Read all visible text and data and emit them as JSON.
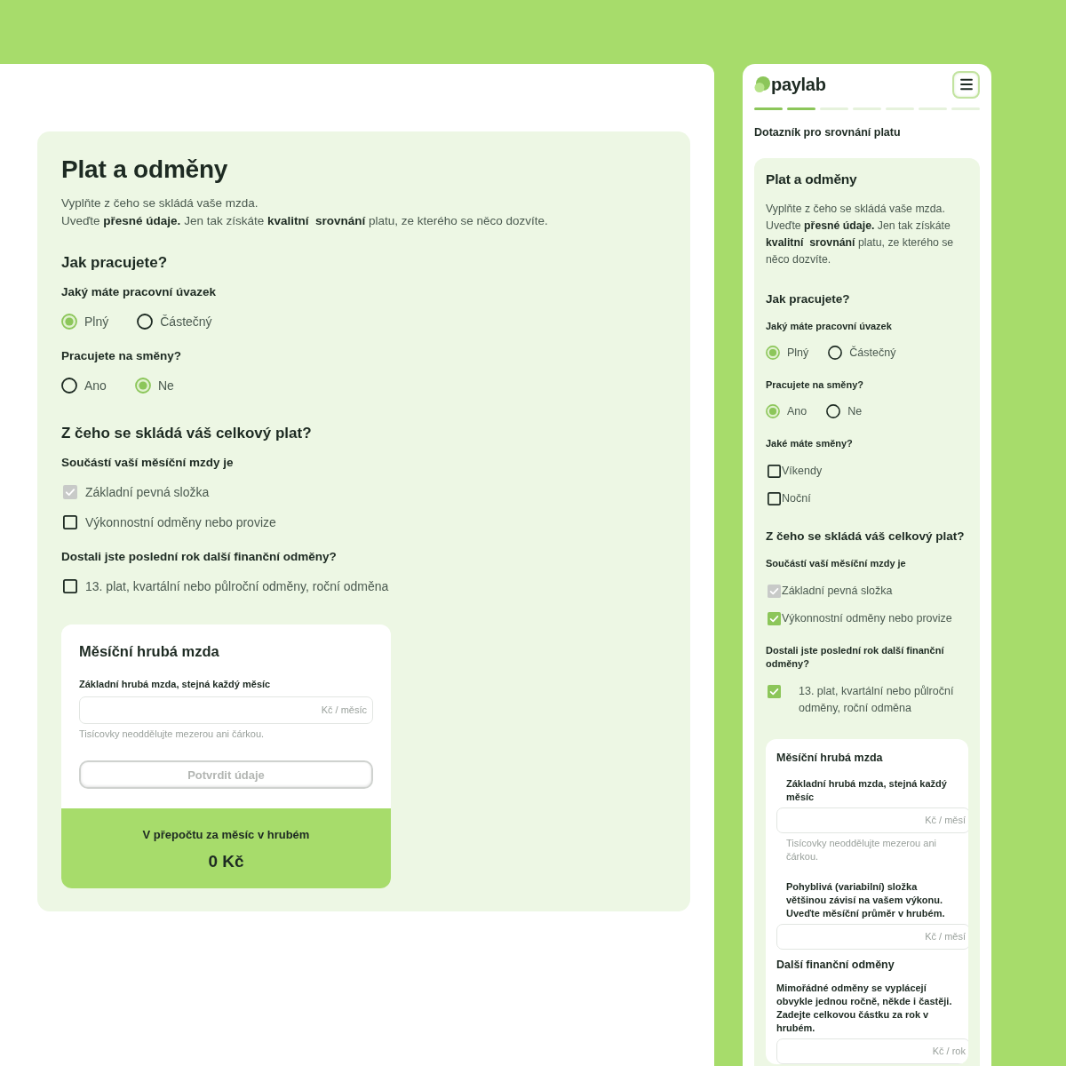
{
  "desktop": {
    "form": {
      "title": "Plat a odměny",
      "intro": [
        "Vyplňte z čeho se skládá vaše mzda.",
        "Uveďte **přesné údaje.** Jen tak získáte **kvalitní  srovnání** platu, ze kterého se něco dozvíte."
      ],
      "sections": [
        {
          "heading": "Jak pracujete?",
          "questions": [
            {
              "kind": "radio",
              "label": "Jaký máte pracovní úvazek",
              "options": [
                {
                  "label": "Plný",
                  "selected": true
                },
                {
                  "label": "Částečný",
                  "selected": false
                }
              ]
            },
            {
              "kind": "radio",
              "label": "Pracujete na směny?",
              "options": [
                {
                  "label": "Ano",
                  "selected": false
                },
                {
                  "label": "Ne",
                  "selected": true
                }
              ]
            }
          ]
        },
        {
          "heading": "Z čeho se skládá váš celkový plat?",
          "questions": [
            {
              "kind": "checkbox",
              "label": "Součástí vaší měsíční mzdy je",
              "options": [
                {
                  "label": "Základní pevná složka",
                  "checked": true,
                  "disabled": true
                },
                {
                  "label": "Výkonnostní odměny nebo provize",
                  "checked": false,
                  "disabled": false
                }
              ]
            },
            {
              "kind": "checkbox",
              "label": "Dostali jste poslední rok další finanční odměny?",
              "options": [
                {
                  "label": "13. plat, kvartální nebo půlroční odměny, roční odměna",
                  "checked": false,
                  "disabled": false
                }
              ]
            }
          ]
        }
      ],
      "salary_card": {
        "sections": [
          {
            "title": "Měsíční hrubá mzda",
            "fields": [
              {
                "label": "Základní hrubá mzda, stejná každý měsíc",
                "suffix": "Kč / měsíc",
                "hint": "Tisícovky neoddělujte mezerou ani čárkou."
              }
            ]
          }
        ],
        "button": {
          "label": "Potvrdit údaje",
          "disabled": true
        },
        "summary": {
          "label": "V přepočtu za měsíc v hrubém",
          "value": "0 Kč"
        }
      }
    }
  },
  "mobile": {
    "logo": "paylab",
    "progress": {
      "steps": [
        {
          "done": true
        },
        {
          "done": true
        },
        {
          "done": false
        },
        {
          "done": false
        },
        {
          "done": false
        },
        {
          "done": false
        },
        {
          "done": false
        }
      ]
    },
    "subtitle": "Dotazník pro srovnání platu",
    "form": {
      "title": "Plat a odměny",
      "intro": [
        "Vyplňte z čeho se skládá vaše mzda.",
        "Uveďte **přesné údaje.** Jen tak získáte **kvalitní  srovnání** platu, ze kterého se něco dozvíte."
      ],
      "sections": [
        {
          "heading": "Jak pracujete?",
          "questions": [
            {
              "kind": "radio",
              "label": "Jaký máte pracovní úvazek",
              "options": [
                {
                  "label": "Plný",
                  "selected": true
                },
                {
                  "label": "Částečný",
                  "selected": false
                }
              ]
            },
            {
              "kind": "radio",
              "label": "Pracujete na směny?",
              "options": [
                {
                  "label": "Ano",
                  "selected": true
                },
                {
                  "label": "Ne",
                  "selected": false
                }
              ]
            },
            {
              "kind": "checkbox",
              "label": "Jaké máte směny?",
              "options": [
                {
                  "label": "Víkendy",
                  "checked": false,
                  "disabled": false
                },
                {
                  "label": "Noční",
                  "checked": false,
                  "disabled": false
                }
              ]
            }
          ]
        },
        {
          "heading": "Z čeho se skládá váš celkový plat?",
          "questions": [
            {
              "kind": "checkbox",
              "label": "Součástí vaší měsíční mzdy je",
              "options": [
                {
                  "label": "Základní pevná složka",
                  "checked": true,
                  "disabled": true
                },
                {
                  "label": "Výkonnostní odměny nebo provize",
                  "checked": true,
                  "disabled": false
                }
              ]
            },
            {
              "kind": "wide",
              "label": "Dostali jste poslední rok další finanční odměny?",
              "options": [
                {
                  "label": "13. plat, kvartální nebo půlroční odměny, roční odměna",
                  "checked": true,
                  "disabled": false
                }
              ]
            }
          ]
        }
      ],
      "salary_card": {
        "sections": [
          {
            "title": "Měsíční hrubá mzda",
            "fields": [
              {
                "label": "Základní hrubá mzda, stejná každý měsíc",
                "suffix": "Kč / měsí",
                "hint": "Tisícovky neoddělujte mezerou ani čárkou."
              },
              {
                "label": "Pohyblivá (variabilní) složka většinou závisí na vašem výkonu. Uveďte měsíční průměr v hrubém.",
                "suffix": "Kč / měsí"
              }
            ]
          },
          {
            "title": "Další finanční odměny",
            "fields": [
              {
                "label": "Mimořádné odměny se vyplácejí obvykle jednou ročně, někde i častěji. Zadejte celkovou částku za rok v hrubém.",
                "suffix": "Kč / rok"
              }
            ]
          }
        ]
      }
    }
  }
}
